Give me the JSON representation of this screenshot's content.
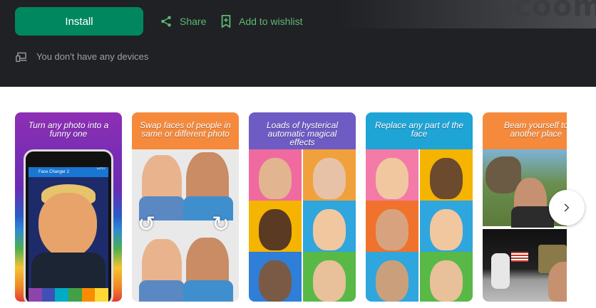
{
  "header": {
    "install_label": "Install",
    "share_label": "Share",
    "wishlist_label": "Add to wishlist",
    "devices_text": "You don't have any devices",
    "background_word": "scoom"
  },
  "screenshots": [
    {
      "caption": "Turn any photo into a funny one",
      "phone_title": "Face Changer 2",
      "phone_time": "12:07"
    },
    {
      "caption": "Swap faces of people in same or different photo"
    },
    {
      "caption": "Loads of hysterical automatic magical effects"
    },
    {
      "caption": "Replace any part of the face"
    },
    {
      "caption": "Beam yourself to another place"
    }
  ],
  "colors": {
    "accent": "#01875f",
    "action_text": "#5bb974",
    "header_bg": "#202124"
  },
  "icons": {
    "share": "share-icon",
    "wishlist": "bookmark-plus-icon",
    "devices": "devices-icon",
    "next": "chevron-right-icon"
  }
}
